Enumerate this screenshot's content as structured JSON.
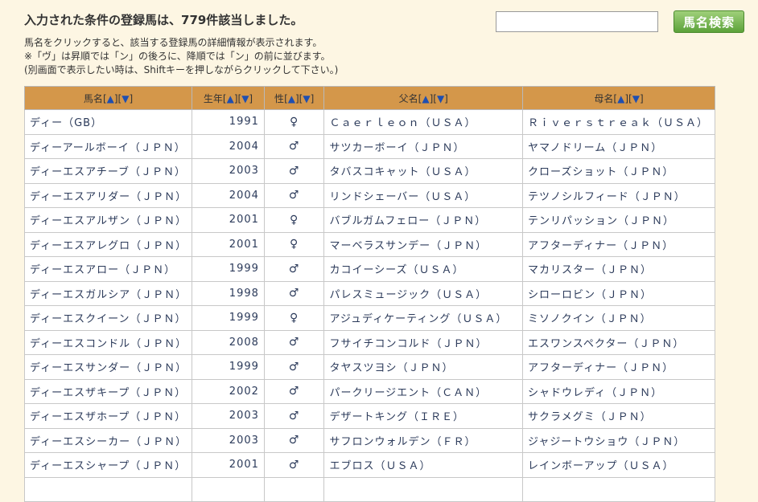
{
  "header": {
    "result_title": "入力された条件の登録馬は、779件該当しました。",
    "search_input_value": "",
    "search_button_label": "馬名検索"
  },
  "notes": [
    "馬名をクリックすると、該当する登録馬の詳細情報が表示されます。",
    "※「ヴ」は昇順では「ン」の後ろに、降順では「ン」の前に並びます。",
    "(別画面で表示したい時は、Shiftキーを押しながらクリックして下さい。)"
  ],
  "table": {
    "columns": [
      {
        "label": "馬名",
        "asc": "▲",
        "desc": "▼"
      },
      {
        "label": "生年",
        "asc": "▲",
        "desc": "▼"
      },
      {
        "label": "性",
        "asc": "▲",
        "desc": "▼"
      },
      {
        "label": "父名",
        "asc": "▲",
        "desc": "▼"
      },
      {
        "label": "母名",
        "asc": "▲",
        "desc": "▼"
      }
    ],
    "rows": [
      {
        "name": "ディー（GB）",
        "year": "1991",
        "sex": "♀",
        "sire": "Ｃａｅｒｌｅｏｎ（ＵＳＡ）",
        "dam": "Ｒｉｖｅｒｓｔｒｅａｋ（ＵＳＡ）"
      },
      {
        "name": "ディーアールボーイ（ＪＰＮ）",
        "year": "2004",
        "sex": "♂",
        "sire": "サツカーボーイ（ＪＰＮ）",
        "dam": "ヤマノドリーム（ＪＰＮ）"
      },
      {
        "name": "ディーエスアチーブ（ＪＰＮ）",
        "year": "2003",
        "sex": "♂",
        "sire": "タバスコキャット（ＵＳＡ）",
        "dam": "クローズショット（ＪＰＮ）"
      },
      {
        "name": "ディーエスアリダー（ＪＰＮ）",
        "year": "2004",
        "sex": "♂",
        "sire": "リンドシェーバー（ＵＳＡ）",
        "dam": "テツノシルフィード（ＪＰＮ）"
      },
      {
        "name": "ディーエスアルザン（ＪＰＮ）",
        "year": "2001",
        "sex": "♀",
        "sire": "バブルガムフェロー（ＪＰＮ）",
        "dam": "テンリパッション（ＪＰＮ）"
      },
      {
        "name": "ディーエスアレグロ（ＪＰＮ）",
        "year": "2001",
        "sex": "♀",
        "sire": "マーベラスサンデー（ＪＰＮ）",
        "dam": "アフターディナー（ＪＰＮ）"
      },
      {
        "name": "ディーエスアロー（ＪＰＮ）",
        "year": "1999",
        "sex": "♂",
        "sire": "カコイーシーズ（ＵＳＡ）",
        "dam": "マカリスター（ＪＰＮ）"
      },
      {
        "name": "ディーエスガルシア（ＪＰＮ）",
        "year": "1998",
        "sex": "♂",
        "sire": "パレスミュージック（ＵＳＡ）",
        "dam": "シローロビン（ＪＰＮ）"
      },
      {
        "name": "ディーエスクイーン（ＪＰＮ）",
        "year": "1999",
        "sex": "♀",
        "sire": "アジュディケーティング（ＵＳＡ）",
        "dam": "ミソノクイン（ＪＰＮ）"
      },
      {
        "name": "ディーエスコンドル（ＪＰＮ）",
        "year": "2008",
        "sex": "♂",
        "sire": "フサイチコンコルド（ＪＰＮ）",
        "dam": "エスワンスペクター（ＪＰＮ）"
      },
      {
        "name": "ディーエスサンダー（ＪＰＮ）",
        "year": "1999",
        "sex": "♂",
        "sire": "タヤスツヨシ（ＪＰＮ）",
        "dam": "アフターディナー（ＪＰＮ）"
      },
      {
        "name": "ディーエスザキープ（ＪＰＮ）",
        "year": "2002",
        "sex": "♂",
        "sire": "パークリージエント（ＣＡＮ）",
        "dam": "シャドウレディ（ＪＰＮ）"
      },
      {
        "name": "ディーエスザホープ（ＪＰＮ）",
        "year": "2003",
        "sex": "♂",
        "sire": "デザートキング（ＩＲＥ）",
        "dam": "サクラメグミ（ＪＰＮ）"
      },
      {
        "name": "ディーエスシーカー（ＪＰＮ）",
        "year": "2003",
        "sex": "♂",
        "sire": "サフロンウォルデン（ＦＲ）",
        "dam": "ジャジートウショウ（ＪＰＮ）"
      },
      {
        "name": "ディーエスシャープ（ＪＰＮ）",
        "year": "2001",
        "sex": "♂",
        "sire": "エブロス（ＵＳＡ）",
        "dam": "レインボーアップ（ＵＳＡ）"
      },
      {
        "name": "",
        "year": "",
        "sex": "",
        "sire": "",
        "dam": ""
      }
    ]
  }
}
